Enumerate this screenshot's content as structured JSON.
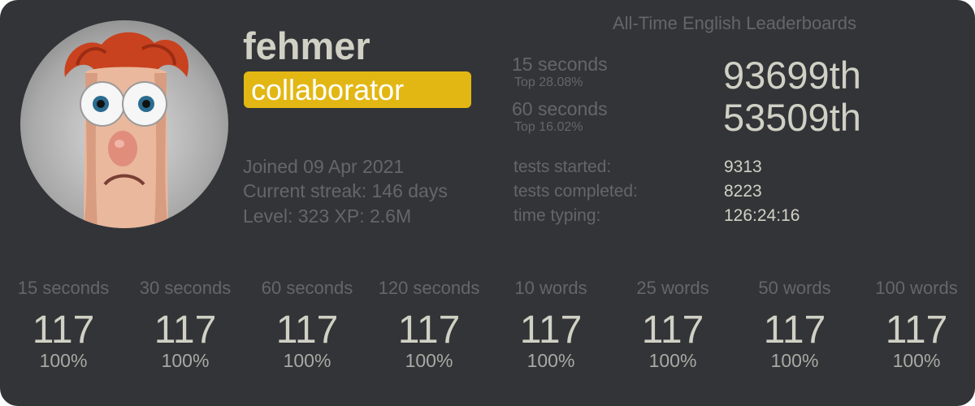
{
  "profile": {
    "username": "fehmer",
    "badge": "collaborator",
    "joined": "Joined 09 Apr 2021",
    "streak": "Current streak: 146 days",
    "level": "Level: 323 XP: 2.6M"
  },
  "leaderboards": {
    "title": "All-Time English Leaderboards",
    "entries": [
      {
        "mode": "15 seconds",
        "top": "Top 28.08%",
        "rank": "93699th"
      },
      {
        "mode": "60 seconds",
        "top": "Top 16.02%",
        "rank": "53509th"
      }
    ]
  },
  "stats": [
    {
      "label": "tests started:",
      "value": "9313"
    },
    {
      "label": "tests completed:",
      "value": "8223"
    },
    {
      "label": "time typing:",
      "value": "126:24:16"
    }
  ],
  "personal_bests": [
    {
      "label": "15 seconds",
      "wpm": "117",
      "acc": "100%"
    },
    {
      "label": "30 seconds",
      "wpm": "117",
      "acc": "100%"
    },
    {
      "label": "60 seconds",
      "wpm": "117",
      "acc": "100%"
    },
    {
      "label": "120 seconds",
      "wpm": "117",
      "acc": "100%"
    },
    {
      "label": "10 words",
      "wpm": "117",
      "acc": "100%"
    },
    {
      "label": "25 words",
      "wpm": "117",
      "acc": "100%"
    },
    {
      "label": "50 words",
      "wpm": "117",
      "acc": "100%"
    },
    {
      "label": "100 words",
      "wpm": "117",
      "acc": "100%"
    }
  ],
  "colors": {
    "background": "#323437",
    "main_text": "#d1d0c5",
    "sub_text": "#646669",
    "badge": "#e2b714"
  },
  "icons": {
    "avatar": "user-avatar-illustration"
  }
}
